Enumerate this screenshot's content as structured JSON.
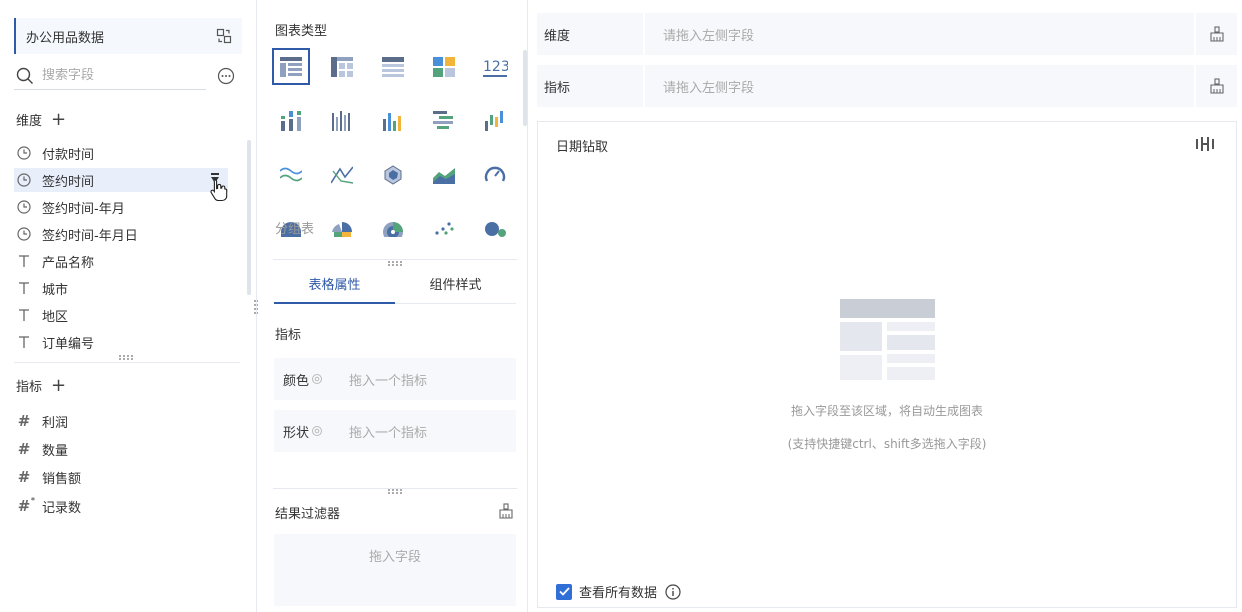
{
  "left": {
    "dataset_name": "办公用品数据",
    "search_placeholder": "搜索字段",
    "dimensions_title": "维度",
    "dimension_fields": [
      {
        "label": "付款时间",
        "type": "time"
      },
      {
        "label": "签约时间",
        "type": "time"
      },
      {
        "label": "签约时间-年月",
        "type": "time"
      },
      {
        "label": "签约时间-年月日",
        "type": "time"
      },
      {
        "label": "产品名称",
        "type": "text"
      },
      {
        "label": "城市",
        "type": "text"
      },
      {
        "label": "地区",
        "type": "text"
      },
      {
        "label": "订单编号",
        "type": "text"
      }
    ],
    "metrics_title": "指标",
    "metric_fields": [
      {
        "label": "利润",
        "type": "number"
      },
      {
        "label": "数量",
        "type": "number"
      },
      {
        "label": "销售额",
        "type": "number"
      },
      {
        "label": "记录数",
        "type": "count"
      }
    ]
  },
  "middle": {
    "chart_types_title": "图表类型",
    "selected_chart_name": "分组表",
    "tabs": [
      {
        "label": "表格属性",
        "active": true
      },
      {
        "label": "组件样式",
        "active": false
      }
    ],
    "metrics_section_title": "指标",
    "props": [
      {
        "label": "颜色",
        "placeholder": "拖入一个指标"
      },
      {
        "label": "形状",
        "placeholder": "拖入一个指标"
      }
    ],
    "result_filter_title": "结果过滤器",
    "result_filter_placeholder": "拖入字段"
  },
  "right": {
    "dimension_label": "维度",
    "dimension_placeholder": "请拖入左侧字段",
    "metric_label": "指标",
    "metric_placeholder": "请拖入左侧字段",
    "canvas_title": "日期钻取",
    "empty_line1": "拖入字段至该区域，将自动生成图表",
    "empty_line2": "(支持快捷键ctrl、shift多选拖入字段)",
    "show_all_data_label": "查看所有数据",
    "show_all_data_checked": true
  },
  "colors": {
    "accent": "#2f5aa8",
    "checkbox": "#2f6fd6",
    "number_field": "#2aa58a"
  }
}
